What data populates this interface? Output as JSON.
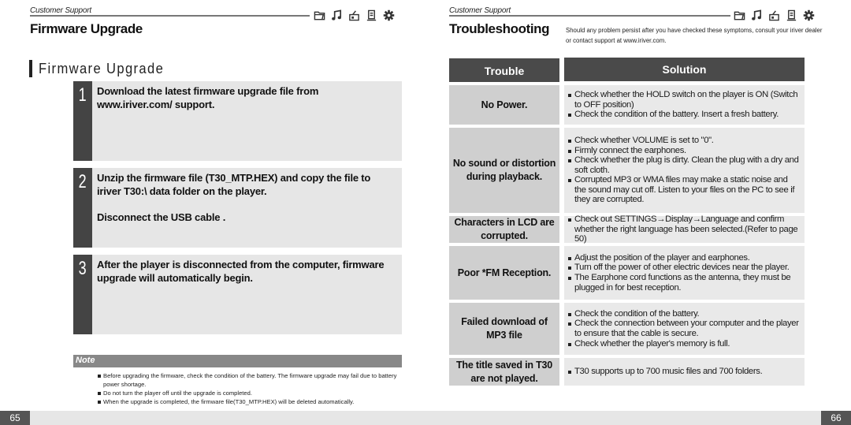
{
  "left_page": {
    "breadcrumb": "Customer Support",
    "heading": "Firmware Upgrade",
    "section_title": "Firmware Upgrade",
    "icons": [
      "folder-icon",
      "music-note-icon",
      "radio-icon",
      "document-list-icon",
      "gear-icon"
    ],
    "steps": [
      {
        "number": "1",
        "paragraphs": [
          "Download the latest firmware upgrade file from www.iriver.com/ support."
        ]
      },
      {
        "number": "2",
        "paragraphs": [
          "Unzip the firmware file (T30_MTP.HEX) and copy the file to iriver T30:\\ data folder on the player.",
          "Disconnect the USB cable ."
        ]
      },
      {
        "number": "3",
        "paragraphs": [
          "After the player is disconnected from the computer, firmware upgrade will automatically begin."
        ]
      }
    ],
    "note": {
      "label": "Note",
      "items": [
        "Before upgrading the firmware, check the condition of the battery. The firmware upgrade may fail due to battery power shortage.",
        "Do not turn the player off until the upgrade is completed.",
        "When the upgrade is completed, the firmware file(T30_MTP.HEX)  will be deleted automatically."
      ]
    },
    "page_number": "65"
  },
  "right_page": {
    "breadcrumb": "Customer Support",
    "heading": "Troubleshooting",
    "intro": "Should any problem persist after you have checked these symptoms, consult your iriver dealer or contact support at www.iriver.com.",
    "icons": [
      "folder-icon",
      "music-note-icon",
      "radio-icon",
      "document-list-icon",
      "gear-icon"
    ],
    "table": {
      "headers": {
        "trouble": "Trouble",
        "solution": "Solution"
      },
      "rows": [
        {
          "trouble": "No Power.",
          "solutions": [
            "Check whether the HOLD switch on the player is ON (Switch to OFF position)",
            "Check the condition of the battery. Insert a fresh battery."
          ]
        },
        {
          "trouble": "No sound or distortion during playback.",
          "solutions": [
            "Check whether VOLUME is set to \"0\".",
            "Firmly connect the earphones.",
            "Check whether the plug is dirty. Clean the plug with a dry and soft cloth.",
            "Corrupted MP3 or WMA files may make a static noise and the sound may cut off. Listen to your files on the PC to see if they are corrupted."
          ]
        },
        {
          "trouble": "Characters in LCD are corrupted.",
          "solutions": [
            "Check out SETTINGS→Display→Language and confirm whether the right language has been selected.(Refer to page 50)"
          ]
        },
        {
          "trouble": "Poor *FM Reception.",
          "solutions": [
            "Adjust the position of the player and earphones.",
            "Turn off the power of other electric devices near the player.",
            "The Earphone cord functions as the antenna, they must be plugged in for best reception."
          ]
        },
        {
          "trouble": "Failed download of MP3 file",
          "solutions": [
            "Check the condition of the battery.",
            "Check the connection between your computer and the player to ensure that the cable is secure.",
            "Check whether the player's memory is full."
          ]
        },
        {
          "trouble": "The title saved in T30 are not played.",
          "solutions": [
            "T30 supports up to 700 music files and 700 folders."
          ]
        }
      ]
    },
    "page_number": "66"
  },
  "colors": {
    "header_dark": "#4a4a4a",
    "step_number_bg": "#444444",
    "panel_light": "#e6e6e6",
    "trouble_cell": "#cfcfcf",
    "note_bar": "#888888"
  }
}
